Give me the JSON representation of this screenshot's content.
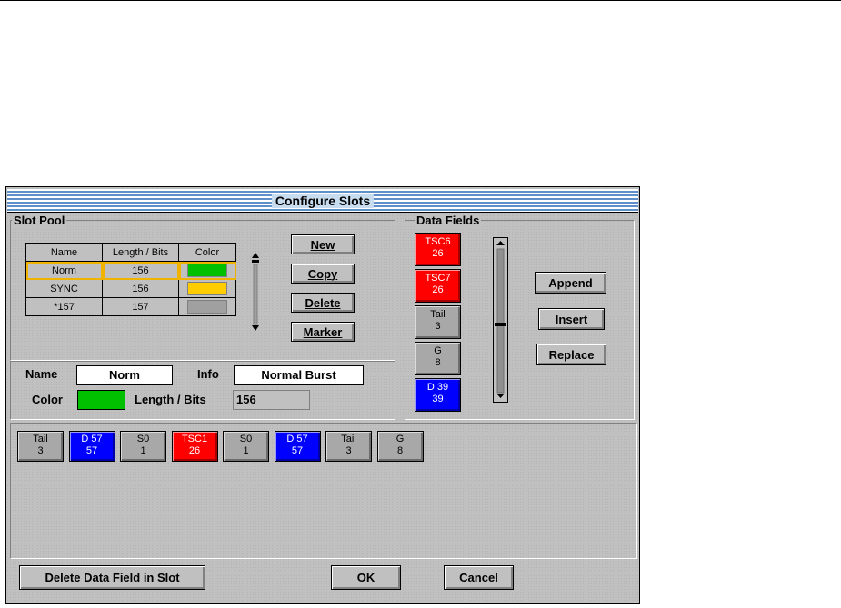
{
  "window": {
    "title": "Configure Slots"
  },
  "slot_pool": {
    "title": "Slot Pool",
    "columns": [
      "Name",
      "Length / Bits",
      "Color"
    ],
    "rows": [
      {
        "name": "Norm",
        "length": "156",
        "color": "#00c000",
        "selected": true
      },
      {
        "name": "SYNC",
        "length": "156",
        "color": "#ffcc00",
        "selected": false
      },
      {
        "name": "*157",
        "length": "157",
        "color": "#a0a0a0",
        "selected": false
      }
    ],
    "buttons": {
      "new": "New",
      "copy": "Copy",
      "delete": "Delete",
      "marker": "Marker"
    }
  },
  "details": {
    "name_label": "Name",
    "name_value": "Norm",
    "info_label": "Info",
    "info_value": "Normal Burst",
    "color_label": "Color",
    "color_value": "#00c000",
    "length_label": "Length / Bits",
    "length_value": "156"
  },
  "data_fields": {
    "title": "Data Fields",
    "items": [
      {
        "name": "TSC6",
        "bits": "26",
        "color": "#ff0000",
        "text_color": "#ffffff"
      },
      {
        "name": "TSC7",
        "bits": "26",
        "color": "#ff0000",
        "text_color": "#ffffff"
      },
      {
        "name": "Tail",
        "bits": "3",
        "color": "#a8a8a8",
        "text_color": "#000000"
      },
      {
        "name": "G",
        "bits": "8",
        "color": "#a8a8a8",
        "text_color": "#000000"
      },
      {
        "name": "D 39",
        "bits": "39",
        "color": "#0000ff",
        "text_color": "#ffffff"
      }
    ],
    "buttons": {
      "append": "Append",
      "insert": "Insert",
      "replace": "Replace"
    }
  },
  "slot_fields": [
    {
      "name": "Tail",
      "bits": "3",
      "color": "#a8a8a8",
      "text_color": "#000000"
    },
    {
      "name": "D 57",
      "bits": "57",
      "color": "#0000ff",
      "text_color": "#ffffff"
    },
    {
      "name": "S0",
      "bits": "1",
      "color": "#a8a8a8",
      "text_color": "#000000"
    },
    {
      "name": "TSC1",
      "bits": "26",
      "color": "#ff0000",
      "text_color": "#ffffff"
    },
    {
      "name": "S0",
      "bits": "1",
      "color": "#a8a8a8",
      "text_color": "#000000"
    },
    {
      "name": "D 57",
      "bits": "57",
      "color": "#0000ff",
      "text_color": "#ffffff"
    },
    {
      "name": "Tail",
      "bits": "3",
      "color": "#a8a8a8",
      "text_color": "#000000"
    },
    {
      "name": "G",
      "bits": "8",
      "color": "#a8a8a8",
      "text_color": "#000000"
    }
  ],
  "footer": {
    "delete_field": "Delete Data Field in Slot",
    "ok": "OK",
    "cancel": "Cancel"
  },
  "icons": {
    "scroll_up": "scroll-up-icon",
    "scroll_down": "scroll-down-icon",
    "scroll_thumb": "scroll-thumb-icon"
  }
}
